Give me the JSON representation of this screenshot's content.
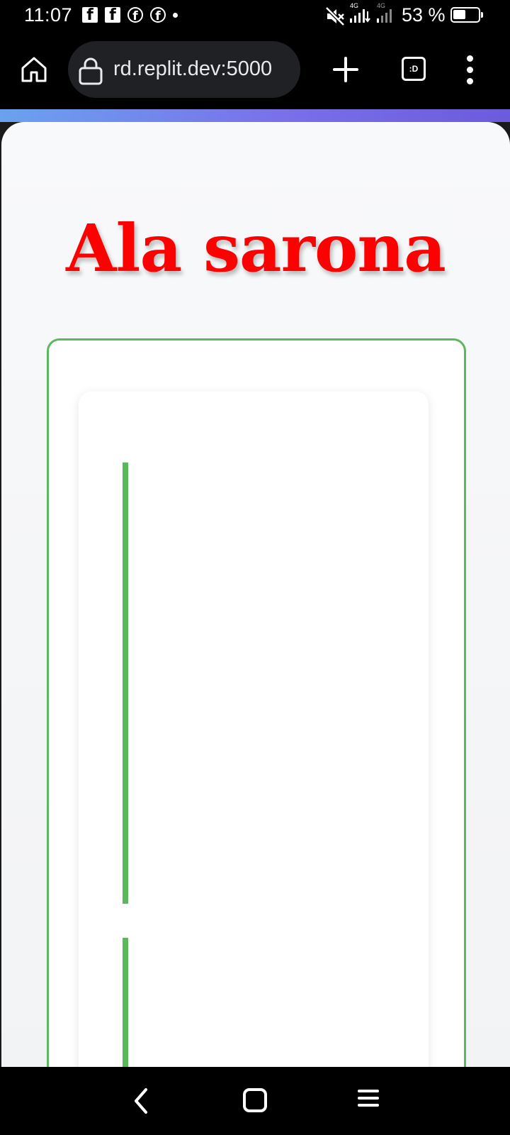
{
  "status_bar": {
    "time": "11:07",
    "battery_percent": "53 %",
    "battery_level": 0.53,
    "network": "4G",
    "icons": [
      "facebook-square-icon",
      "facebook-square-icon",
      "facebook-circle-icon",
      "facebook-circle-icon",
      "notification-dot-icon",
      "mute-icon",
      "signal-icon",
      "signal-icon",
      "battery-icon"
    ]
  },
  "browser": {
    "url": "rd.replit.dev:5000",
    "tabs_label": ":D",
    "icons": [
      "home-icon",
      "lock-icon",
      "plus-icon",
      "tabs-icon",
      "more-vert-icon"
    ]
  },
  "page": {
    "title": "Ala sarona",
    "title_color": "#ff0000",
    "accent_color": "#5cb85c",
    "header_gradient": [
      "#6aa2ef",
      "#6c5bdc"
    ]
  },
  "nav_bar": {
    "icons": [
      "back-icon",
      "home-square-icon",
      "recents-menu-icon"
    ]
  }
}
